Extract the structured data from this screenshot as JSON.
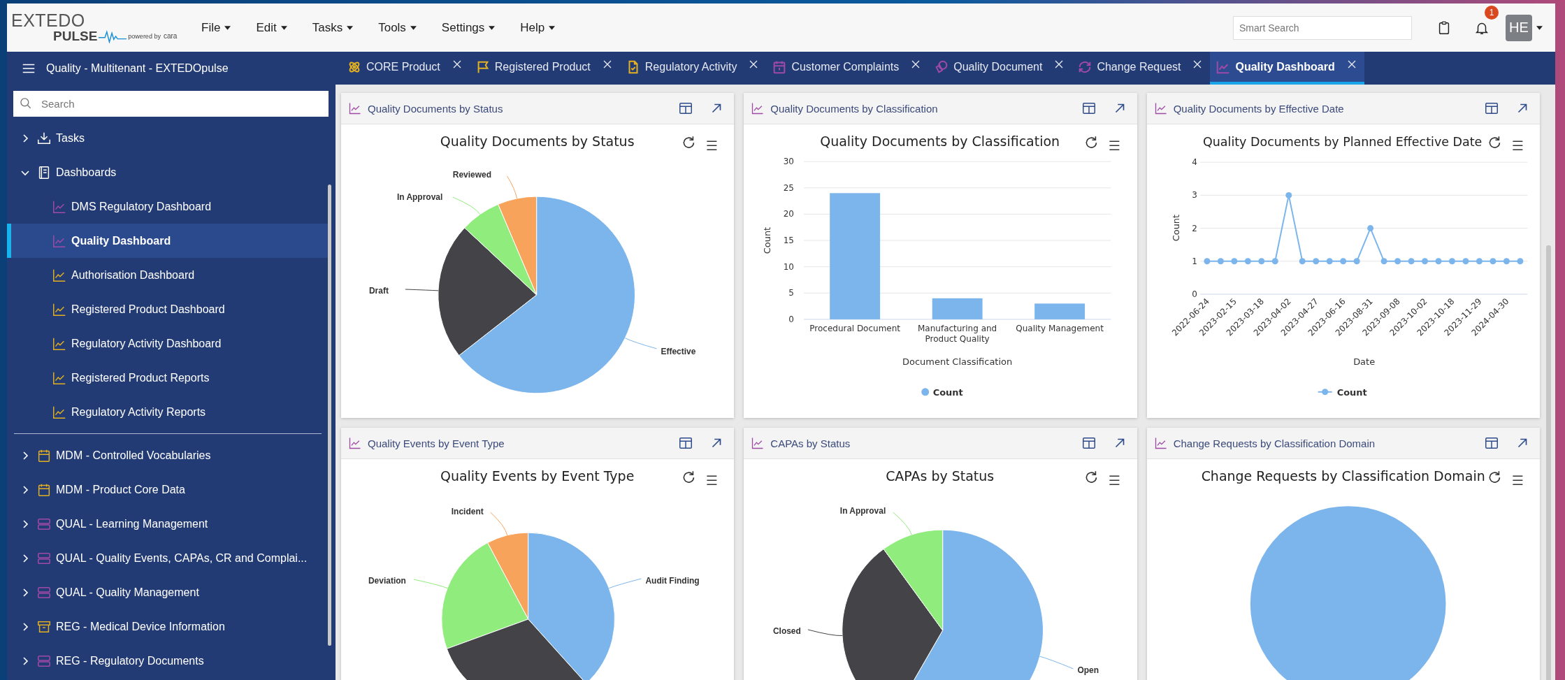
{
  "logo": {
    "word": "EXTEDO",
    "product": "PULSE",
    "powered": "powered by",
    "brand": "cara"
  },
  "menus": [
    "File",
    "Edit",
    "Tasks",
    "Tools",
    "Settings",
    "Help"
  ],
  "toolbar": {
    "search": {
      "placeholder": "Smart Search"
    },
    "notifications": "1",
    "avatar": "HE"
  },
  "sidebar": {
    "title": "Quality - Multitenant - EXTEDOpulse",
    "search": {
      "placeholder": "Search"
    },
    "tree": [
      {
        "label": "Tasks",
        "kind": "tray",
        "color": "#ffffff",
        "expanded": false,
        "selected": false
      },
      {
        "label": "Dashboards",
        "kind": "book",
        "color": "#ffffff",
        "expanded": true,
        "selected": false,
        "children": [
          {
            "label": "DMS Regulatory Dashboard",
            "kind": "chart",
            "color": "#a04aa8",
            "selected": false
          },
          {
            "label": "Quality Dashboard",
            "kind": "chart",
            "color": "#a04aa8",
            "selected": true
          },
          {
            "label": "Authorisation Dashboard",
            "kind": "chart",
            "color": "#e2b020",
            "selected": false
          },
          {
            "label": "Registered Product Dashboard",
            "kind": "chart",
            "color": "#e2b020",
            "selected": false
          },
          {
            "label": "Regulatory Activity Dashboard",
            "kind": "chart",
            "color": "#e2b020",
            "selected": false
          },
          {
            "label": "Registered Product Reports",
            "kind": "chart",
            "color": "#e2b020",
            "selected": false
          },
          {
            "label": "Regulatory Activity Reports",
            "kind": "chart",
            "color": "#e2b020",
            "selected": false
          }
        ]
      },
      {
        "label": "MDM - Controlled Vocabularies",
        "kind": "calendar",
        "color": "#e2b020",
        "expanded": false,
        "selected": false
      },
      {
        "label": "MDM - Product Core Data",
        "kind": "calendar",
        "color": "#e2b020",
        "expanded": false,
        "selected": false
      },
      {
        "label": "QUAL - Learning Management",
        "kind": "server",
        "color": "#a04aa8",
        "expanded": false,
        "selected": false
      },
      {
        "label": "QUAL - Quality Events, CAPAs, CR and Complai...",
        "kind": "server",
        "color": "#a04aa8",
        "expanded": false,
        "selected": false
      },
      {
        "label": "QUAL - Quality Management",
        "kind": "server",
        "color": "#a04aa8",
        "expanded": false,
        "selected": false
      },
      {
        "label": "REG - Medical Device Information",
        "kind": "archive",
        "color": "#e2b020",
        "expanded": false,
        "selected": false
      },
      {
        "label": "REG - Regulatory Documents",
        "kind": "server",
        "color": "#a04aa8",
        "expanded": false,
        "selected": false
      }
    ]
  },
  "tabs": [
    {
      "label": "CORE Product",
      "kind": "atom",
      "color": "#e2b020",
      "selected": false
    },
    {
      "label": "Registered Product",
      "kind": "flag",
      "color": "#e2b020",
      "selected": false
    },
    {
      "label": "Regulatory Activity",
      "kind": "doc",
      "color": "#e2b020",
      "selected": false
    },
    {
      "label": "Customer Complaints",
      "kind": "calendar",
      "color": "#a04aa8",
      "selected": false
    },
    {
      "label": "Quality Document",
      "kind": "docs",
      "color": "#a04aa8",
      "selected": false
    },
    {
      "label": "Change Request",
      "kind": "refresh",
      "color": "#a04aa8",
      "selected": false
    },
    {
      "label": "Quality Dashboard",
      "kind": "chart",
      "color": "#a04aa8",
      "selected": true
    }
  ],
  "cards": [
    {
      "header": "Quality Documents by Status",
      "kind": "pie",
      "title": "Quality Documents by Status",
      "slices": [
        {
          "label": "Effective",
          "color": "#7cb5ec"
        },
        {
          "label": "Draft",
          "color": "#434348"
        },
        {
          "label": "In Approval",
          "color": "#90ed7d"
        },
        {
          "label": "Reviewed",
          "color": "#f7a35c"
        }
      ]
    },
    {
      "header": "Quality Documents by Classification",
      "kind": "chart",
      "chart_data": {
        "type": "bar",
        "grid": true,
        "title": "Quality Documents by Classification",
        "xlabel": "Document Classification",
        "ylabel": "Count",
        "categories": [
          "Procedural Document",
          "Manufacturing and Product Quality",
          "Quality Management"
        ],
        "series": [
          {
            "name": "Count",
            "color": "#7cb5ec",
            "values": [
              24,
              4,
              3
            ]
          }
        ],
        "ylim": [
          0,
          30
        ],
        "yticks": [
          0,
          5,
          10,
          15,
          20,
          25,
          30
        ]
      }
    },
    {
      "header": "Quality Documents by Effective Date",
      "kind": "chart",
      "chart_data": {
        "type": "line",
        "grid": true,
        "title": "Quality Documents by Planned Effective Date",
        "xlabel": "Date",
        "ylabel": "Count",
        "categories": [
          "2022-06-24",
          null,
          "2023-02-15",
          null,
          "2023-03-18",
          null,
          "2023-04-02",
          null,
          "2023-04-27",
          null,
          "2023-06-16",
          null,
          "2023-08-31",
          null,
          "2023-09-08",
          null,
          "2023-10-02",
          null,
          "2023-10-18",
          null,
          "2023-11-29",
          null,
          "2024-04-30",
          null
        ],
        "series": [
          {
            "name": "Count",
            "color": "#7cb5ec",
            "marker": true,
            "values": [
              1,
              1,
              1,
              1,
              1,
              1,
              3,
              1,
              1,
              1,
              1,
              1,
              2,
              1,
              1,
              1,
              1,
              1,
              1,
              1,
              1,
              1,
              1,
              1
            ]
          }
        ],
        "ylim": [
          0,
          4
        ],
        "yticks": [
          0,
          1,
          2,
          3,
          4
        ]
      }
    },
    {
      "header": "Quality Events by Event Type",
      "kind": "pie",
      "title": "Quality Events by Event Type",
      "slices": [
        {
          "label": "Incident",
          "color": "#f7a35c"
        },
        {
          "label": "Deviation",
          "color": "#90ed7d"
        },
        {
          "label": "Audit Finding",
          "color": "#7cb5ec"
        },
        {
          "color": "#434348"
        }
      ]
    },
    {
      "header": "CAPAs by Status",
      "kind": "pie",
      "title": "CAPAs by Status",
      "slices": [
        {
          "label": "Open",
          "color": "#7cb5ec"
        },
        {
          "label": "Closed",
          "color": "#434348"
        },
        {
          "label": "In Approval",
          "color": "#90ed7d"
        }
      ]
    },
    {
      "header": "Change Requests by Classification Domain",
      "kind": "pie",
      "title": "Change Requests by Classification Domain",
      "slices": [
        {
          "color": "#7cb5ec"
        }
      ]
    }
  ]
}
